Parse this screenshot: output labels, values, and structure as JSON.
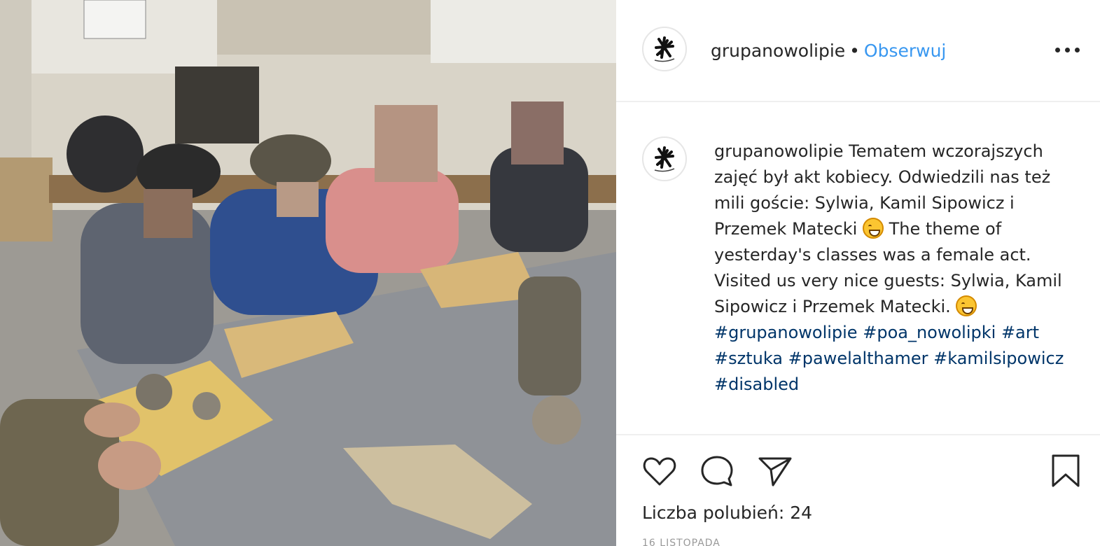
{
  "post": {
    "photo_alt": "",
    "username": "grupanowolipie",
    "separator": "•",
    "follow_label": "Obserwuj",
    "more_icon": "more-options-icon",
    "caption": {
      "username": "grupanowolipie",
      "text_pl_1": "Tematem wczorajszych zajęć był akt kobiecy. Odwiedzili nas też mili goście: Sylwia, Kamil Sipowicz i Przemek Matecki",
      "text_en": "The theme of yesterday's classes was a female act. Visited us very nice guests: Sylwia, Kamil Sipowicz i Przemek Matecki.",
      "emoji_icon": "grinning-face-emoji",
      "hashtags": [
        "#grupanowolipie",
        "#poa_nowolipki",
        "#art",
        "#sztuka",
        "#pawelalthamer",
        "#kamilsipowicz",
        "#disabled"
      ]
    },
    "actions": {
      "like_icon": "heart-icon",
      "comment_icon": "comment-icon",
      "share_icon": "share-icon",
      "save_icon": "bookmark-icon"
    },
    "likes_text": "Liczba polubień: 24",
    "date_text": "16 LISTOPADA"
  },
  "colors": {
    "link_blue": "#3897f0",
    "hashtag": "#003569",
    "text": "#262626",
    "divider": "#efefef"
  }
}
